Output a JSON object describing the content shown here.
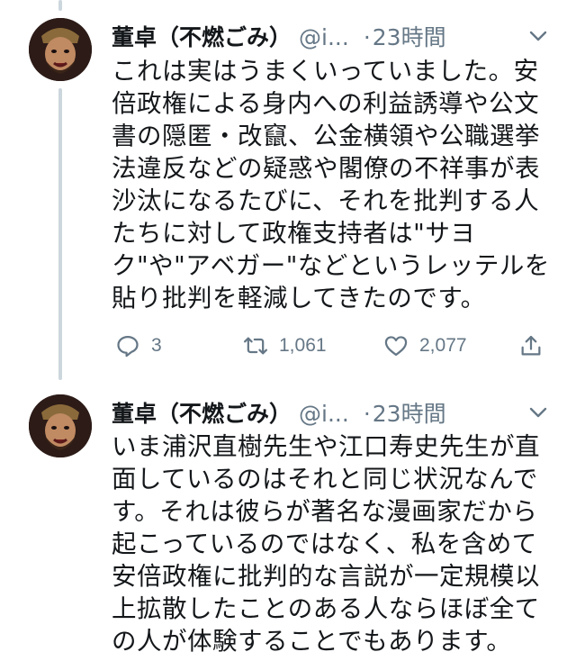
{
  "tweets": [
    {
      "name": "董卓（不燃ごみ）",
      "handle": "@i...",
      "dot": "·",
      "time": "23時間",
      "lines": [
        "これは実はうまくいっていました。安",
        "倍政権による身内への利益誘導や公文",
        "書の隠匿・改竄、公金横領や公職選挙",
        "法違反などの疑惑や閣僚の不祥事が表",
        "沙汰になるたびに、それを批判する人",
        "たちに対して政権支持者は\"サヨ",
        "ク\"や\"アベガー\"などというレッテルを",
        "貼り批判を軽減してきたのです。"
      ],
      "actions": {
        "reply_count": "3",
        "retweet_count": "1,061",
        "like_count": "2,077"
      }
    },
    {
      "name": "董卓（不燃ごみ）",
      "handle": "@i...",
      "dot": "·",
      "time": "23時間",
      "lines": [
        "いま浦沢直樹先生や江口寿史先生が直",
        "面しているのはそれと同じ状況なんで",
        "す。それは彼らが著名な漫画家だから",
        "起こっているのではなく、私を含めて",
        "安倍政権に批判的な言説が一定規模以",
        "上拡散したことのある人ならほぼ全て",
        "の人が体験することでもあります。"
      ]
    }
  ],
  "colors": {
    "text": "#14171a",
    "muted": "#657786",
    "thread_line": "#ccd6dd"
  },
  "icons": [
    "avatar",
    "chevron-down-icon",
    "reply-icon",
    "retweet-icon",
    "like-icon",
    "share-icon"
  ]
}
